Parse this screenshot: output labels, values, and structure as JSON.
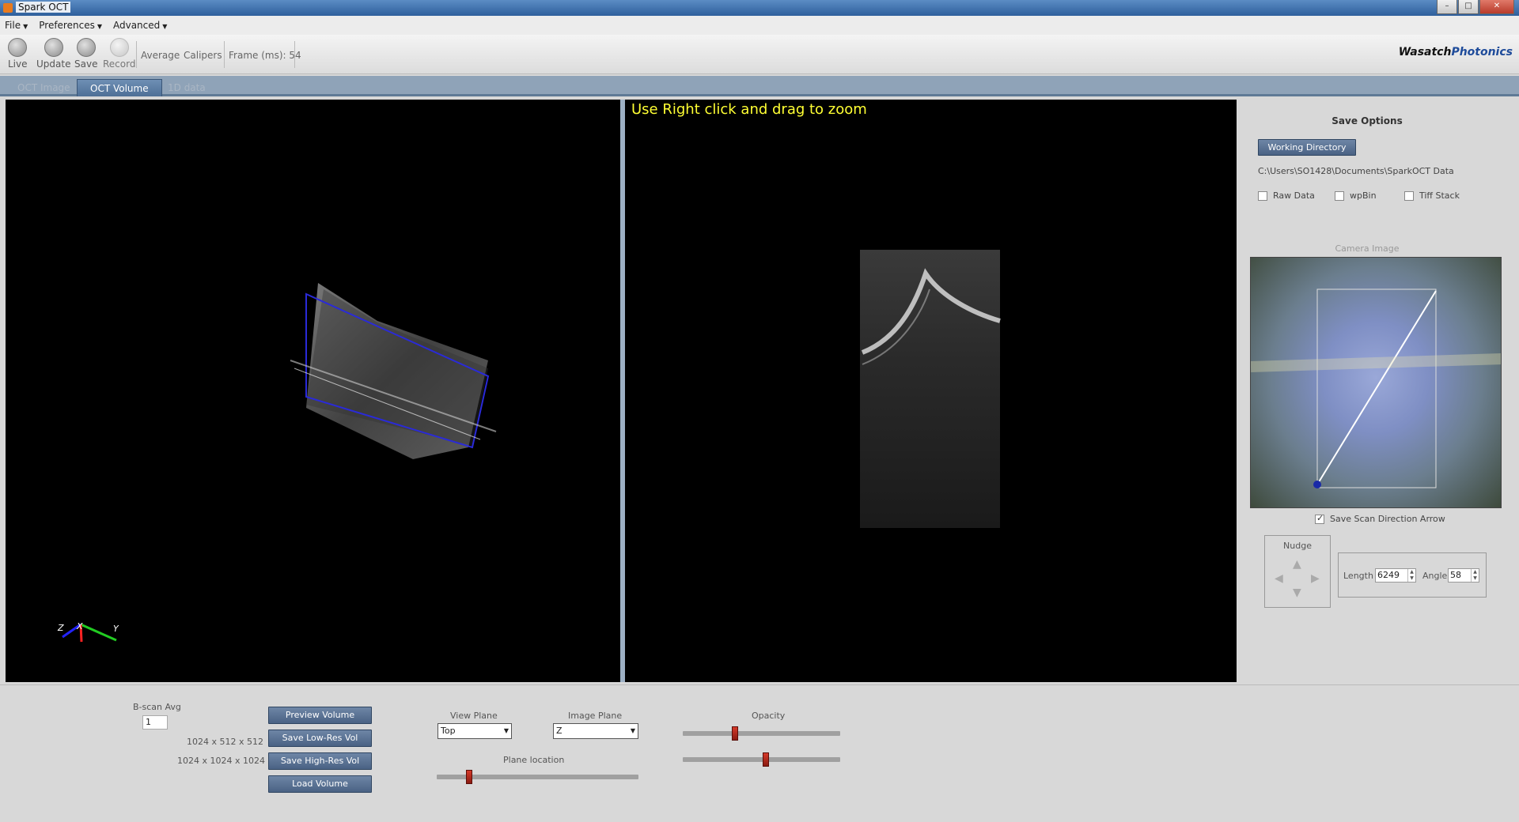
{
  "window": {
    "title": "Spark OCT",
    "min": "–",
    "max": "□",
    "close": "✕"
  },
  "menu": [
    {
      "label": "File"
    },
    {
      "label": "Preferences"
    },
    {
      "label": "Advanced"
    }
  ],
  "toolbar": {
    "live": "Live",
    "update": "Update",
    "save": "Save",
    "record": "Record",
    "average": "Average",
    "calipers": "Calipers",
    "frame": "Frame (ms): 54"
  },
  "logo": {
    "left": "Wasatch",
    "right": "Photonics"
  },
  "tabs": [
    {
      "label": "OCT Image"
    },
    {
      "label": "OCT Volume"
    },
    {
      "label": "1D data"
    }
  ],
  "viewer": {
    "hint": "Use Right click and drag to zoom",
    "axes": {
      "z": "Z",
      "x": "X",
      "y": "Y"
    }
  },
  "side": {
    "save_options": "Save Options",
    "working_dir_btn": "Working Directory",
    "path": "C:\\Users\\SO1428\\Documents\\SparkOCT Data",
    "raw_data": "Raw Data",
    "wpbin": "wpBin",
    "tiff_stack": "Tiff Stack",
    "camera_image": "Camera Image",
    "save_scan_arrow": "Save Scan Direction Arrow",
    "nudge": "Nudge",
    "length_label": "Length",
    "length_value": "6249",
    "angle_label": "Angle",
    "angle_value": "58"
  },
  "bottom": {
    "bscan_avg_label": "B-scan Avg",
    "bscan_avg_value": "1",
    "low_res_dims": "1024 x 512 x 512",
    "high_res_dims": "1024 x 1024 x 1024",
    "preview_btn": "Preview Volume",
    "save_low_btn": "Save Low-Res Vol",
    "save_high_btn": "Save High-Res Vol",
    "load_btn": "Load Volume",
    "view_plane_label": "View Plane",
    "view_plane_value": "Top",
    "image_plane_label": "Image Plane",
    "image_plane_value": "Z",
    "plane_location_label": "Plane location",
    "plane_location_level": 0.16,
    "opacity_label": "Opacity",
    "opacity_level_1": 0.33,
    "opacity_level_2": 0.53
  }
}
